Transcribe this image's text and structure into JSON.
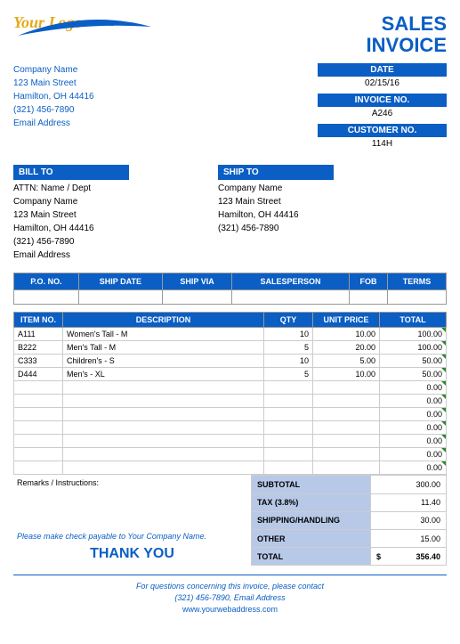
{
  "logo_text": "Your Logo",
  "title_line1": "SALES",
  "title_line2": "INVOICE",
  "from": {
    "company": "Company Name",
    "street": "123 Main Street",
    "city": "Hamilton, OH  44416",
    "phone": "(321) 456-7890",
    "email": "Email Address"
  },
  "meta": {
    "date_hdr": "DATE",
    "date_val": "02/15/16",
    "inv_hdr": "INVOICE NO.",
    "inv_val": "A246",
    "cust_hdr": "CUSTOMER NO.",
    "cust_val": "114H"
  },
  "billto_hdr": "BILL TO",
  "shipto_hdr": "SHIP TO",
  "billto": {
    "attn": "ATTN: Name / Dept",
    "company": "Company Name",
    "street": "123 Main Street",
    "city": "Hamilton, OH  44416",
    "phone": "(321) 456-7890",
    "email": "Email Address"
  },
  "shipto": {
    "company": "Company Name",
    "street": "123 Main Street",
    "city": "Hamilton, OH  44416",
    "phone": "(321) 456-7890"
  },
  "ship_hdrs": {
    "po": "P.O. NO.",
    "date": "SHIP DATE",
    "via": "SHIP VIA",
    "sales": "SALESPERSON",
    "fob": "FOB",
    "terms": "TERMS"
  },
  "item_hdrs": {
    "no": "ITEM NO.",
    "desc": "DESCRIPTION",
    "qty": "QTY",
    "price": "UNIT PRICE",
    "total": "TOTAL"
  },
  "items": [
    {
      "no": "A111",
      "desc": "Women's Tall - M",
      "qty": "10",
      "price": "10.00",
      "total": "100.00"
    },
    {
      "no": "B222",
      "desc": "Men's Tall - M",
      "qty": "5",
      "price": "20.00",
      "total": "100.00"
    },
    {
      "no": "C333",
      "desc": "Children's - S",
      "qty": "10",
      "price": "5.00",
      "total": "50.00"
    },
    {
      "no": "D444",
      "desc": "Men's - XL",
      "qty": "5",
      "price": "10.00",
      "total": "50.00"
    }
  ],
  "empty_total": "0.00",
  "remarks_label": "Remarks / Instructions:",
  "payable": "Please make check payable to Your Company Name.",
  "thanks": "THANK YOU",
  "totals": {
    "subtotal_lbl": "SUBTOTAL",
    "subtotal": "300.00",
    "tax_lbl": "TAX (3.8%)",
    "tax": "11.40",
    "ship_lbl": "SHIPPING/HANDLING",
    "ship": "30.00",
    "other_lbl": "OTHER",
    "other": "15.00",
    "total_lbl": "TOTAL",
    "dollar": "$",
    "total": "356.40"
  },
  "footer": {
    "line1": "For questions concerning this invoice, please contact",
    "line2": "(321) 456-7890, Email Address",
    "link": "www.yourwebaddress.com"
  }
}
